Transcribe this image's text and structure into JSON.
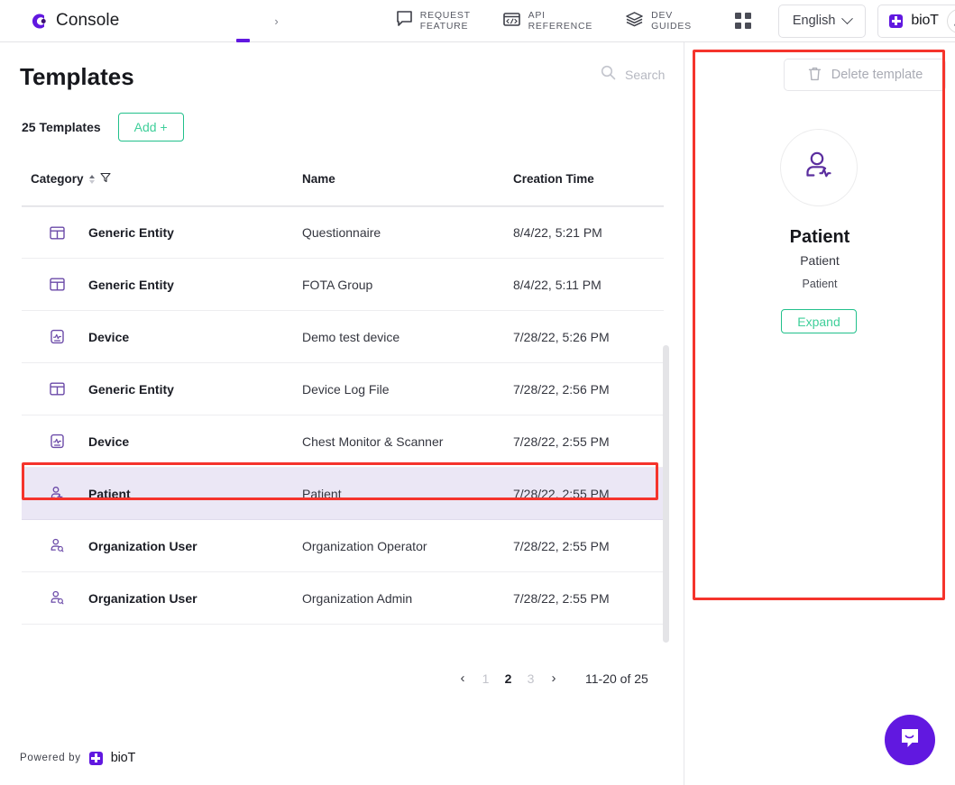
{
  "header": {
    "brand": "Console",
    "breadcrumb_arrow": "›",
    "nav": [
      {
        "label": "REQUEST FEATURE",
        "icon": "chat-bubble-icon"
      },
      {
        "label": "API REFERENCE",
        "icon": "code-window-icon"
      },
      {
        "label": "DEV GUIDES",
        "icon": "books-stack-icon"
      }
    ],
    "apps_icon": "apps-grid-icon",
    "language": "English",
    "account_brand": "bioT",
    "account_icon": "user-account-icon"
  },
  "page": {
    "title": "Templates",
    "count_label": "25 Templates",
    "add_label": "Add +"
  },
  "search": {
    "placeholder": "Search",
    "value": "",
    "icon": "search-icon"
  },
  "table": {
    "columns": {
      "category": "Category",
      "name": "Name",
      "creation_time": "Creation Time"
    },
    "sort_icon": "sort-arrows-icon",
    "filter_icon": "filter-funnel-icon",
    "rows": [
      {
        "icon": "generic-entity-icon",
        "category": "Generic Entity",
        "name": "Questionnaire",
        "time": "8/4/22, 5:21 PM",
        "selected": false
      },
      {
        "icon": "generic-entity-icon",
        "category": "Generic Entity",
        "name": "FOTA Group",
        "time": "8/4/22, 5:11 PM",
        "selected": false
      },
      {
        "icon": "device-icon",
        "category": "Device",
        "name": "Demo test device",
        "time": "7/28/22, 5:26 PM",
        "selected": false
      },
      {
        "icon": "generic-entity-icon",
        "category": "Generic Entity",
        "name": "Device Log File",
        "time": "7/28/22, 2:56 PM",
        "selected": false
      },
      {
        "icon": "device-icon",
        "category": "Device",
        "name": "Chest Monitor & Scanner",
        "time": "7/28/22, 2:55 PM",
        "selected": false
      },
      {
        "icon": "patient-icon",
        "category": "Patient",
        "name": "Patient",
        "time": "7/28/22, 2:55 PM",
        "selected": true
      },
      {
        "icon": "organization-user-icon",
        "category": "Organization User",
        "name": "Organization Operator",
        "time": "7/28/22, 2:55 PM",
        "selected": false
      },
      {
        "icon": "organization-user-icon",
        "category": "Organization User",
        "name": "Organization Admin",
        "time": "7/28/22, 2:55 PM",
        "selected": false
      }
    ]
  },
  "pagination": {
    "prev": "‹",
    "next": "›",
    "pages": [
      "1",
      "2",
      "3"
    ],
    "active_page": "2",
    "range_label": "11-20 of 25"
  },
  "footer": {
    "powered_by": "Powered by",
    "brand": "bioT"
  },
  "details_panel": {
    "delete_label": "Delete template",
    "delete_icon": "trash-icon",
    "avatar_icon": "patient-icon",
    "title": "Patient",
    "subtitle": "Patient",
    "caption": "Patient",
    "expand_label": "Expand"
  },
  "intercom": {
    "icon": "chat-smile-icon"
  },
  "colors": {
    "brand_purple": "#6118e0",
    "accent_green": "#21c08b",
    "selected_row": "#ebe7f5",
    "annotation_red": "#f5342c"
  }
}
